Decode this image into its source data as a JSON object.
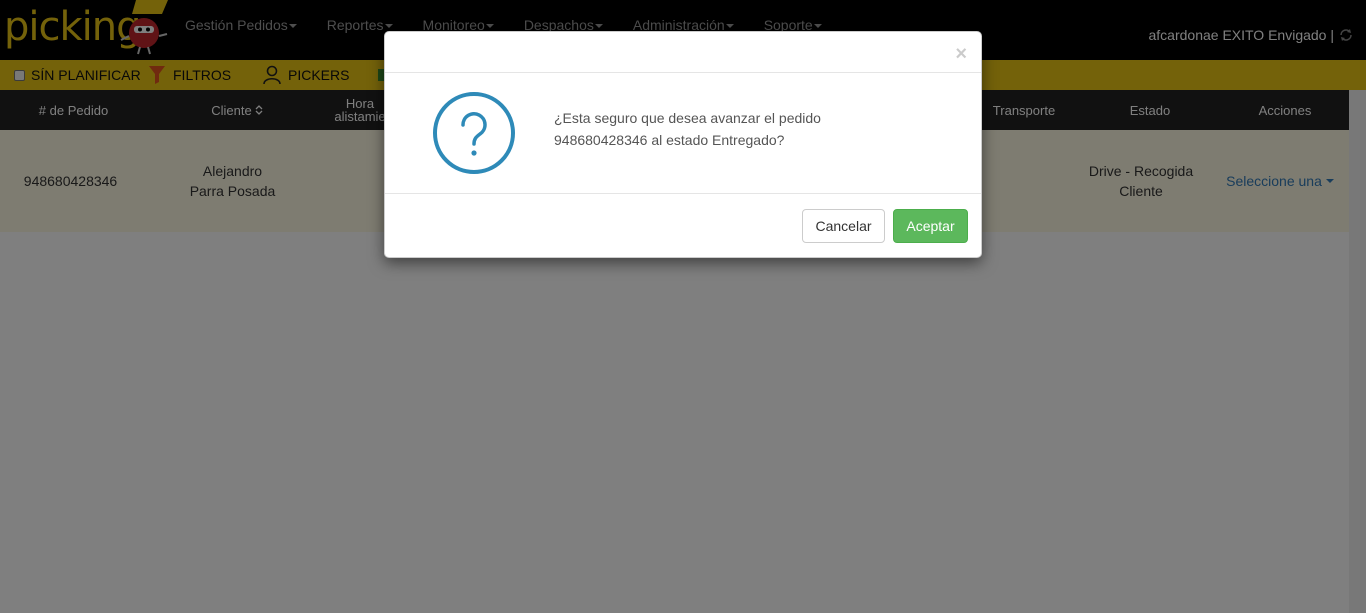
{
  "logo": {
    "text": "picking"
  },
  "nav": {
    "items": [
      {
        "label": "Gestión Pedidos"
      },
      {
        "label": "Reportes"
      },
      {
        "label": "Monitoreo"
      },
      {
        "label": "Despachos"
      },
      {
        "label": "Administración"
      },
      {
        "label": "Soporte"
      }
    ],
    "user": "afcardonae EXITO Envigado |"
  },
  "toolbar": {
    "sin_planificar": "SÍN PLANIFICAR",
    "filtros": "FILTROS",
    "pickers": "PICKERS"
  },
  "table": {
    "headers": {
      "pedido": "# de Pedido",
      "cliente": "Cliente",
      "hora_line1": "Hora",
      "hora_line2": "alistamie",
      "transporte": "Transporte",
      "estado": "Estado",
      "acciones": "Acciones"
    },
    "row": {
      "pedido": "948680428346",
      "cliente_line1": "Alejandro",
      "cliente_line2": "Parra Posada",
      "estado_line1": "Drive - Recogida",
      "estado_line2": "Cliente",
      "acciones": "Seleccione una"
    }
  },
  "modal": {
    "close": "×",
    "message_line1": "¿Esta seguro que desea avanzar el pedido",
    "message_line2": "948680428346 al estado Entregado?",
    "cancel_label": "Cancelar",
    "accept_label": "Aceptar"
  },
  "colors": {
    "brand_yellow": "#e8c415",
    "navbar_bg": "#000000",
    "accept_green": "#5cb85c",
    "question_blue": "#2e8ab8"
  }
}
